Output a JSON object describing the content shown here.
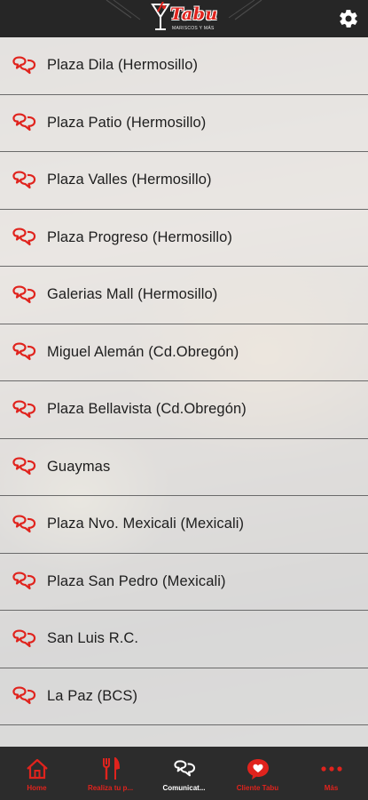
{
  "header": {
    "logo_text": "Tabu",
    "logo_subtext": "MARISCOS Y MÁS",
    "settings_icon": "gear-icon"
  },
  "branches": [
    {
      "label": "Plaza Dila (Hermosillo)"
    },
    {
      "label": "Plaza Patio (Hermosillo)"
    },
    {
      "label": "Plaza Valles (Hermosillo)"
    },
    {
      "label": "Plaza Progreso (Hermosillo)"
    },
    {
      "label": "Galerias Mall (Hermosillo)"
    },
    {
      "label": "Miguel Alemán (Cd.Obregón)"
    },
    {
      "label": "Plaza Bellavista (Cd.Obregón)"
    },
    {
      "label": "Guaymas"
    },
    {
      "label": "Plaza Nvo. Mexicali (Mexicali)"
    },
    {
      "label": "Plaza San Pedro (Mexicali)"
    },
    {
      "label": "San Luis R.C."
    },
    {
      "label": "La Paz (BCS)"
    }
  ],
  "tabbar": {
    "tabs": [
      {
        "label": "Home",
        "icon": "home-icon"
      },
      {
        "label": "Realiza tu p...",
        "icon": "fork-knife-icon"
      },
      {
        "label": "Comunicat...",
        "icon": "chat-bubbles-icon",
        "active": true
      },
      {
        "label": "Cliente Tabu",
        "icon": "heart-icon"
      },
      {
        "label": "Más",
        "icon": "more-icon"
      }
    ]
  },
  "colors": {
    "accent": "#e0231d",
    "header_bg": "#262626",
    "tabbar_bg": "#2c2c2c",
    "divider": "#6a6a6a",
    "text": "#1d1d1d"
  }
}
